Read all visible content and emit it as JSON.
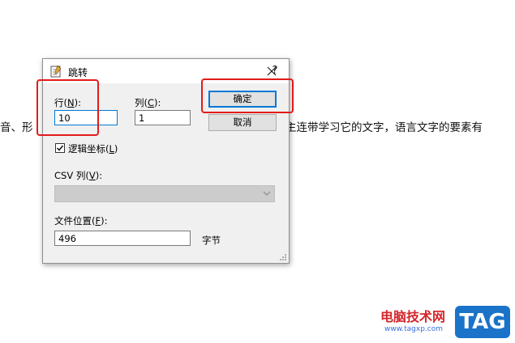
{
  "document": {
    "left_text": "音、形",
    "right_text": "主连带学习它的文字，语言文字的要素有"
  },
  "dialog": {
    "title": "跳转",
    "help": "?",
    "row": {
      "label": "行",
      "accel": "N",
      "label_suffix": "):",
      "value": "10"
    },
    "col": {
      "label": "列(",
      "accel": "C",
      "label_suffix": "):",
      "value": "1"
    },
    "logical_coords": {
      "label": "逻辑坐标(",
      "accel": "L",
      "label_suffix": ")",
      "checked": true
    },
    "csv_col": {
      "label": "CSV 列(",
      "accel": "V",
      "label_suffix": "):",
      "value": ""
    },
    "file_pos": {
      "label": "文件位置(",
      "accel": "F",
      "label_suffix": "):",
      "value": "496",
      "unit": "字节"
    },
    "ok_label": "确定",
    "cancel_label": "取消"
  },
  "watermark": {
    "text": "电脑技术网",
    "url": "www.tagxp.com",
    "tag": "TAG"
  },
  "colors": {
    "highlight": "#e21b1b",
    "default_button_border": "#0078d7",
    "watermark_red": "#d4262b",
    "watermark_blue": "#1a73c8"
  }
}
